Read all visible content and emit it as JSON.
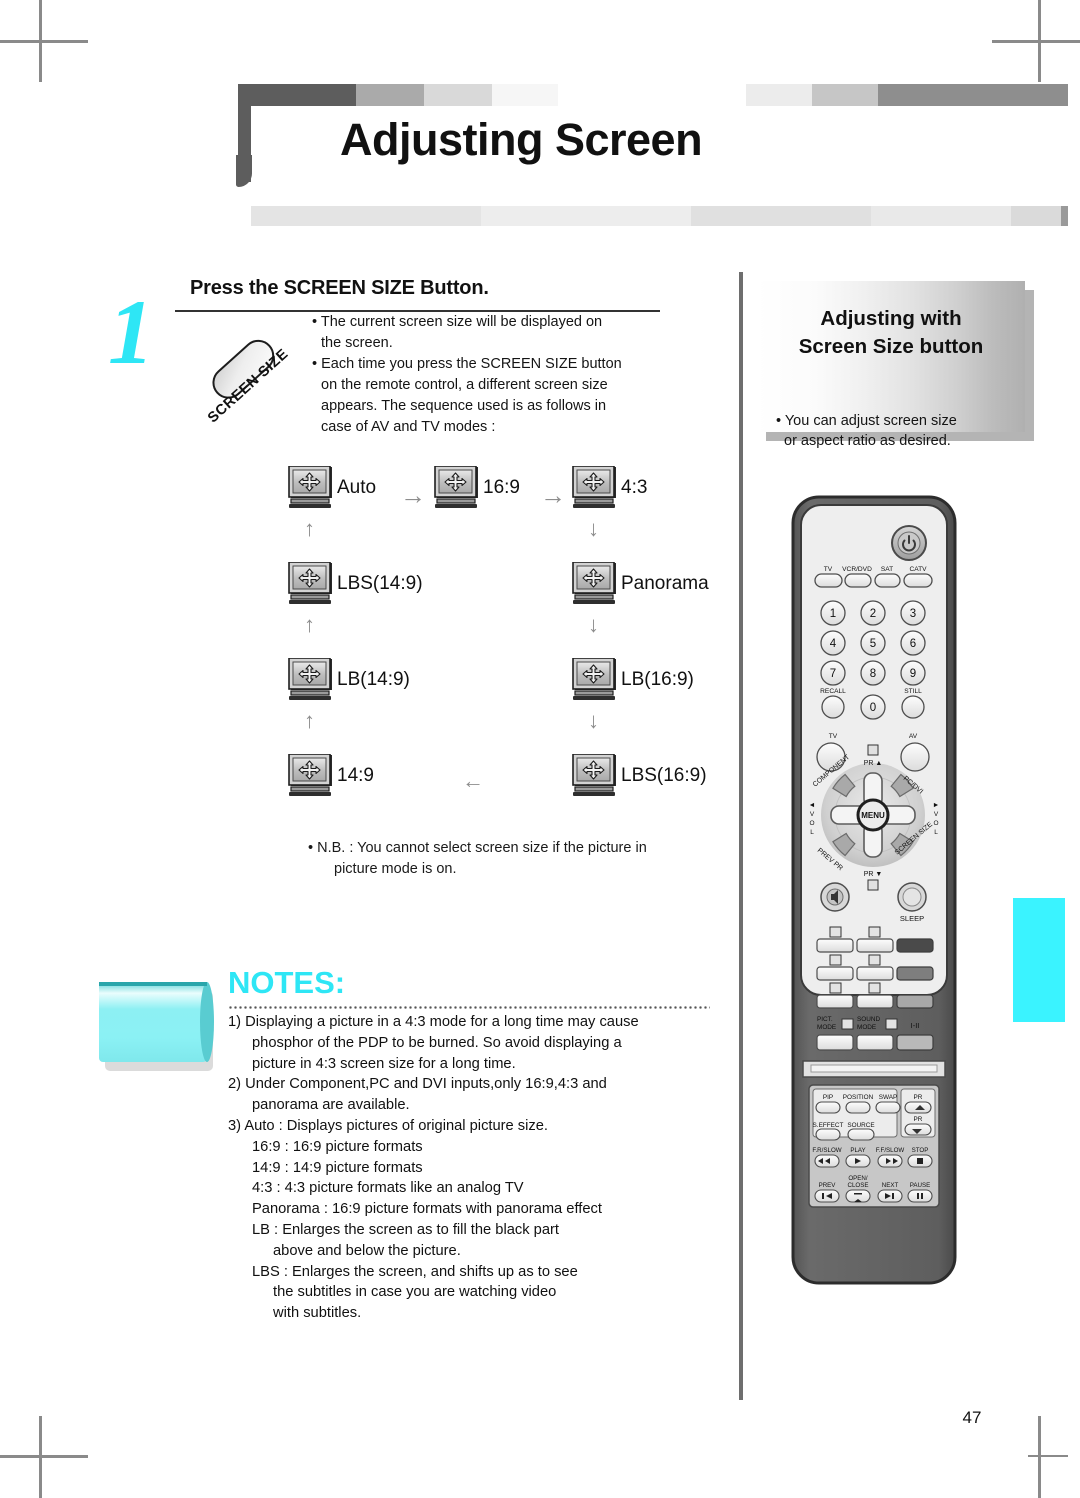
{
  "document": {
    "title": "Adjusting Screen",
    "page_number": "47"
  },
  "step": {
    "number": "1",
    "title": "Press the SCREEN SIZE Button.",
    "button_graphic_label": "SCREEN SIZE",
    "bullets": [
      {
        "line1": "• The current screen size will be displayed on",
        "line2": "the screen."
      },
      {
        "line1": "• Each time you press the SCREEN SIZE button",
        "line2": "on the remote control, a different screen size",
        "line3": "appears. The sequence used is as follows in",
        "line4": "case of AV and TV modes :"
      }
    ]
  },
  "flow": {
    "nodes": [
      {
        "id": "auto",
        "label": "Auto"
      },
      {
        "id": "16-9",
        "label": "16:9"
      },
      {
        "id": "4-3",
        "label": "4:3"
      },
      {
        "id": "panorama",
        "label": "Panorama"
      },
      {
        "id": "lb-16-9",
        "label": "LB(16:9)"
      },
      {
        "id": "lbs-16-9",
        "label": "LBS(16:9)"
      },
      {
        "id": "14-9",
        "label": "14:9"
      },
      {
        "id": "lb-14-9",
        "label": "LB(14:9)"
      },
      {
        "id": "lbs-14-9",
        "label": "LBS(14:9)"
      }
    ],
    "arrows": [
      "→",
      "→",
      "↓",
      "↓",
      "↓",
      "←",
      "↑",
      "↑",
      "↑"
    ],
    "icon_name": "screen-size-monitor-icon"
  },
  "nb_note": {
    "line1": "• N.B. : You cannot select screen size if the picture in",
    "line2": "picture mode is on."
  },
  "notes": {
    "heading": "NOTES:",
    "items": [
      "1) Displaying a picture in a 4:3 mode for a long time may cause",
      "phosphor of the PDP to be burned. So avoid displaying a",
      "picture in 4:3 screen size for a long time.",
      "2) Under Component,PC and DVI inputs,only 16:9,4:3 and",
      "panorama are available.",
      "3) Auto : Displays pictures of original picture size.",
      "16:9 : 16:9 picture formats",
      "14:9 : 14:9 picture formats",
      "4:3 : 4:3 picture formats like an analog TV",
      "Panorama : 16:9 picture formats with panorama effect",
      "LB : Enlarges the screen as to fill the black part",
      "above and below the picture.",
      "LBS : Enlarges the screen, and shifts up as to see",
      "the subtitles in case you are watching video",
      "with subtitles."
    ]
  },
  "sidebar": {
    "title_line1": "Adjusting with",
    "title_line2": "Screen Size button",
    "desc_line1": "• You can adjust screen size",
    "desc_line2": "or aspect ratio as desired."
  },
  "remote": {
    "power_icon": "power-icon",
    "source_buttons": [
      "TV",
      "VCR/DVD",
      "SAT",
      "CATV"
    ],
    "keypad": [
      "1",
      "2",
      "3",
      "4",
      "5",
      "6",
      "7",
      "8",
      "9",
      "0"
    ],
    "recall_label": "RECALL",
    "still_label": "STILL",
    "tv_label": "TV",
    "av_label": "AV",
    "dpad": {
      "up_label": "PR ▲",
      "down_label": "PR ▼",
      "left_label": "◄ V O L",
      "right_label": "► V O L",
      "center_label": "MENU",
      "corner_tl": "COMPONENT",
      "corner_tr": "PC/DVI",
      "corner_bl": "PREV PR",
      "corner_br": "SCREEN SIZE"
    },
    "sleep_label": "SLEEP",
    "mute_icon": "mute-icon",
    "pict_mode_label": "PICT. MODE",
    "sound_mode_label": "SOUND MODE",
    "i_ii_label": "I-II",
    "pip_section": {
      "pip": "PIP",
      "position": "POSITION",
      "swap": "SWAP",
      "pr_up": "PR",
      "pr_down": "PR",
      "s_effect": "S.EFFECT",
      "source": "SOURCE",
      "fr_slow": "F.R/SLOW",
      "play": "PLAY",
      "ff_slow": "F.F/SLOW",
      "stop": "STOP",
      "prev": "PREV",
      "open_close_l1": "OPEN/",
      "open_close_l2": "CLOSE",
      "next": "NEXT",
      "pause": "PAUSE"
    }
  },
  "colors": {
    "accent_cyan": "#2ee6f5",
    "edge_tab": "#3af3ff",
    "header_dark": "#5d5d5d",
    "divider": "#6e6e6e"
  }
}
